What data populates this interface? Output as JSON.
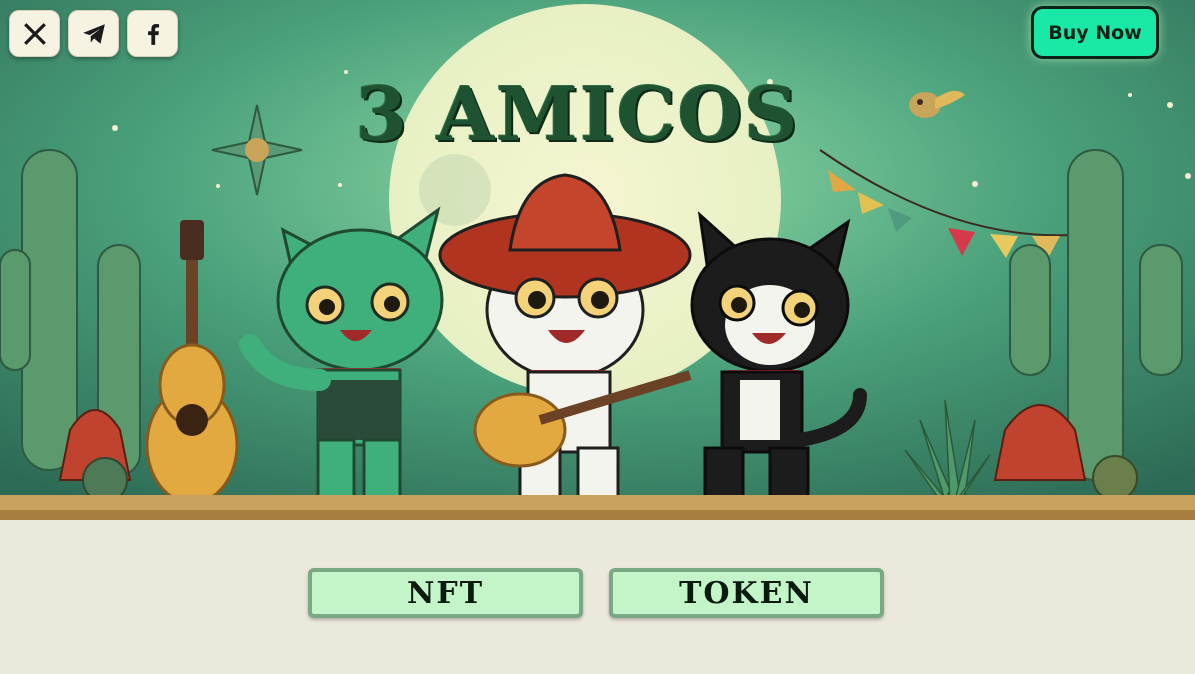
{
  "header": {
    "social": [
      {
        "name": "x-icon"
      },
      {
        "name": "telegram-icon"
      },
      {
        "name": "facebook-icon"
      }
    ],
    "buy_label": "Buy Now"
  },
  "hero": {
    "title": "3 AMICOS"
  },
  "nav": {
    "nft_label": "NFT",
    "token_label": "TOKEN"
  },
  "colors": {
    "accent": "#19e8a6",
    "title": "#1f5230",
    "button_bg": "#c3f5c9",
    "button_border": "#7ba884"
  }
}
